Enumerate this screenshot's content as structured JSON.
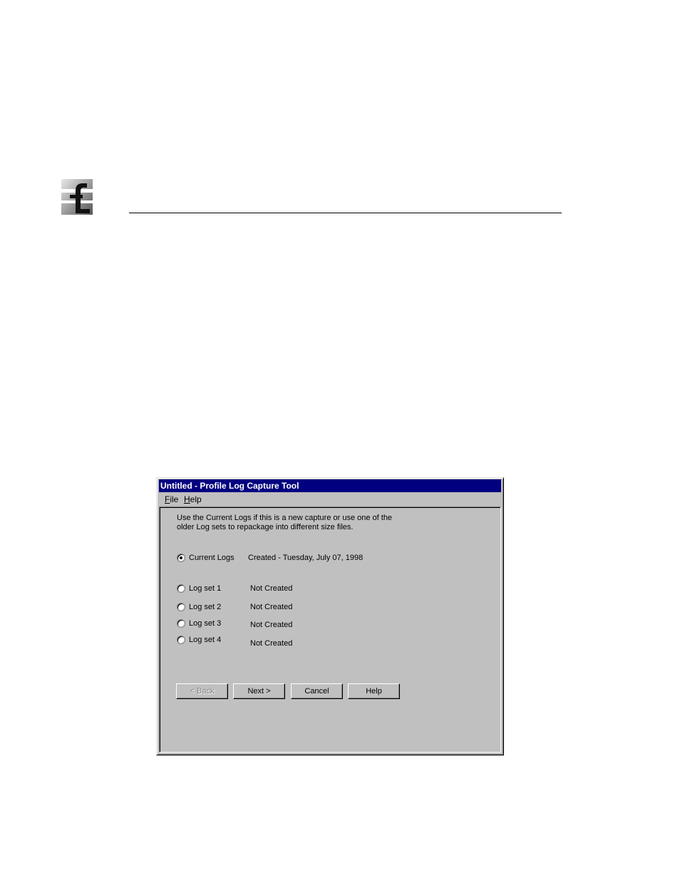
{
  "window": {
    "title": "Untitled - Profile Log Capture Tool"
  },
  "menu": {
    "file": {
      "accel": "F",
      "rest": "ile"
    },
    "help": {
      "accel": "H",
      "rest": "elp"
    }
  },
  "instructions": {
    "line1": "Use the Current Logs if this is a new capture or use one of the",
    "line2": "older Log sets to repackage into different size files."
  },
  "options": [
    {
      "label": "Current Logs",
      "status": "Created - Tuesday, July 07, 1998",
      "selected": true
    },
    {
      "label": "Log set 1",
      "status": "Not Created",
      "selected": false
    },
    {
      "label": "Log set 2",
      "status": "Not Created",
      "selected": false
    },
    {
      "label": "Log set 3",
      "status": "Not Created",
      "selected": false
    },
    {
      "label": "Log set 4",
      "status": "Not Created",
      "selected": false
    }
  ],
  "buttons": {
    "back": "< Back",
    "next": "Next >",
    "cancel": "Cancel",
    "help": "Help"
  }
}
